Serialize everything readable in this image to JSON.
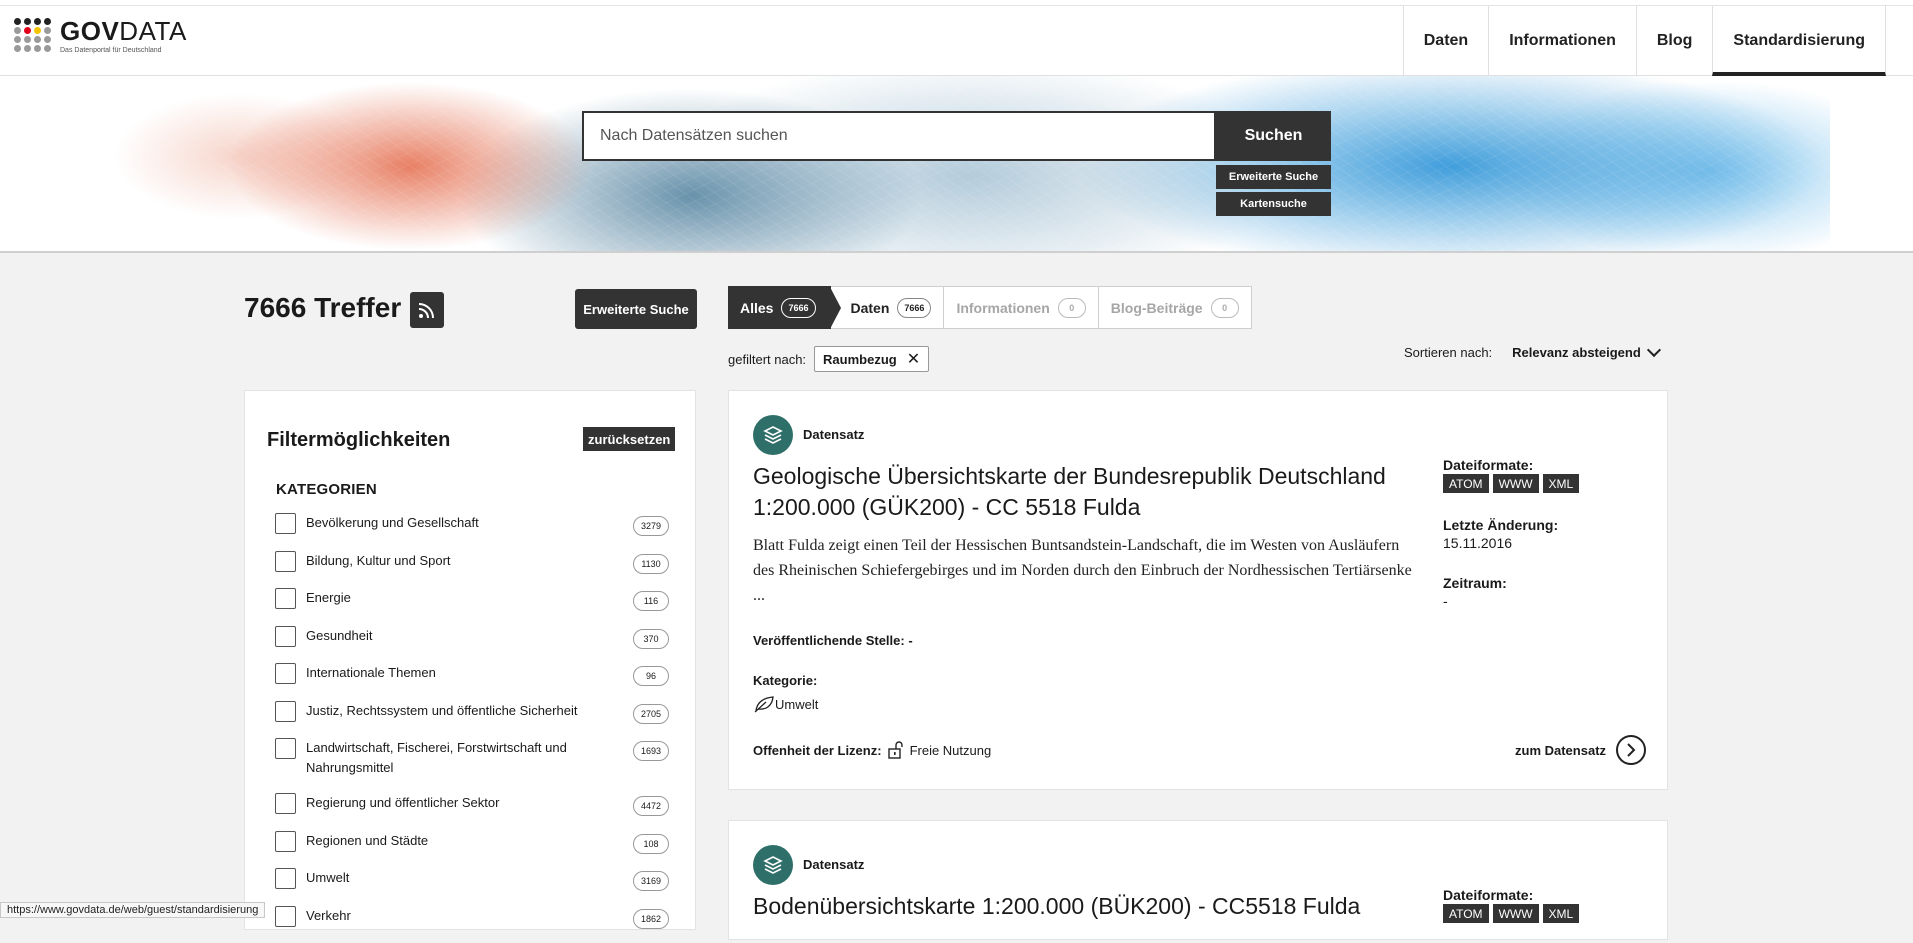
{
  "header": {
    "logo_title_bold": "GOV",
    "logo_title_rest": "DATA",
    "logo_sub": "Das Datenportal für Deutschland",
    "nav": [
      "Daten",
      "Informationen",
      "Blog",
      "Standardisierung"
    ],
    "nav_active": "Standardisierung"
  },
  "hero": {
    "search_placeholder": "Nach Datensätzen suchen",
    "search_button": "Suchen",
    "advanced_search": "Erweiterte Suche",
    "map_search": "Kartensuche"
  },
  "results": {
    "count_text": "7666 Treffer",
    "advanced_button": "Erweiterte Suche",
    "tabs": [
      {
        "label": "Alles",
        "count": "7666"
      },
      {
        "label": "Daten",
        "count": "7666"
      },
      {
        "label": "Informationen",
        "count": "0"
      },
      {
        "label": "Blog-Beiträge",
        "count": "0"
      }
    ],
    "filtered_label": "gefiltert nach:",
    "filter_chip": "Raumbezug",
    "sort_label": "Sortieren nach:",
    "sort_value": "Relevanz absteigend"
  },
  "sidebar": {
    "title": "Filtermöglichkeiten",
    "reset": "zurücksetzen",
    "section": "KATEGORIEN",
    "categories": [
      {
        "label": "Bevölkerung und Gesellschaft",
        "count": "3279"
      },
      {
        "label": "Bildung, Kultur und Sport",
        "count": "1130"
      },
      {
        "label": "Energie",
        "count": "116"
      },
      {
        "label": "Gesundheit",
        "count": "370"
      },
      {
        "label": "Internationale Themen",
        "count": "96"
      },
      {
        "label": "Justiz, Rechtssystem und öffentliche Sicherheit",
        "count": "2705"
      },
      {
        "label": "Landwirtschaft, Fischerei, Forstwirtschaft und Nahrungsmittel",
        "count": "1693"
      },
      {
        "label": "Regierung und öffentlicher Sektor",
        "count": "4472"
      },
      {
        "label": "Regionen und Städte",
        "count": "108"
      },
      {
        "label": "Umwelt",
        "count": "3169"
      },
      {
        "label": "Verkehr",
        "count": "1862"
      }
    ]
  },
  "cards": [
    {
      "type": "Datensatz",
      "title": "Geologische Übersichtskarte der Bundesrepublik Deutschland 1:200.000 (GÜK200) - CC 5518 Fulda",
      "description": "Blatt Fulda zeigt einen Teil der Hessischen Buntsandstein-Landschaft, die im Westen von Ausläufern des Rheinischen Schiefergebirges und im Norden durch den Einbruch der Nordhessischen Tertiärsenke ...",
      "publisher_label": "Veröffentlichende Stelle: -",
      "category_label": "Kategorie:",
      "category_value": "Umwelt",
      "license_label": "Offenheit der Lizenz:",
      "license_value": "Freie Nutzung",
      "formats_label": "Dateiformate:",
      "formats": [
        "ATOM",
        "WWW",
        "XML"
      ],
      "changed_label": "Letzte Änderung:",
      "changed_value": "15.11.2016",
      "period_label": "Zeitraum:",
      "period_value": "-",
      "link": "zum Datensatz"
    },
    {
      "type": "Datensatz",
      "title": "Bodenübersichtskarte 1:200.000 (BÜK200) - CC5518 Fulda",
      "formats_label": "Dateiformate:",
      "formats": [
        "ATOM",
        "WWW",
        "XML"
      ]
    }
  ],
  "statusbar": "https://www.govdata.de/web/guest/standardisierung"
}
